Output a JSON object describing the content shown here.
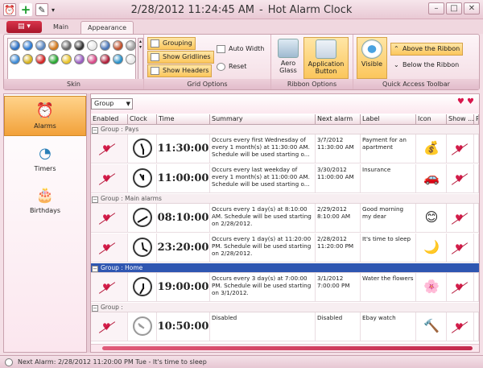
{
  "title": {
    "date": "2/28/2012 11:24:45 AM",
    "sep": "-",
    "app": "Hot Alarm Clock"
  },
  "window_buttons": [
    "–",
    "□",
    "✕"
  ],
  "tabs": {
    "main": "Main",
    "appearance": "Appearance"
  },
  "ribbon": {
    "skin": {
      "label": "Skin",
      "swatches": [
        "#2b6fc4",
        "#2b79d3",
        "#5a86c0",
        "#d3791c",
        "#666",
        "#333",
        "#e8e8e8",
        "#4a75b8",
        "#c04f2a",
        "#a0a0a0",
        "#3d8ad6",
        "#d6b21c",
        "#d52525",
        "#29a832",
        "#e8c32a",
        "#9a5dc0",
        "#d84b89",
        "#b01f3a",
        "#2a91c8",
        "#e8e8e8"
      ]
    },
    "grid_options": {
      "label": "Grid Options",
      "grouping": "Grouping",
      "show_gridlines": "Show Gridlines",
      "show_headers": "Show Headers",
      "auto_width": "Auto Width",
      "reset": "Reset"
    },
    "ribbon_options": {
      "label": "Ribbon Options",
      "aero_line1": "Aero",
      "aero_line2": "Glass",
      "app_line1": "Application",
      "app_line2": "Button"
    },
    "qat": {
      "label": "Quick Access Toolbar",
      "visible": "Visible",
      "above": "Above the Ribbon",
      "below": "Below the Ribbon"
    }
  },
  "nav": {
    "alarms": "Alarms",
    "timers": "Timers",
    "birthdays": "Birthdays"
  },
  "grid": {
    "group_combo": "Group",
    "headers": [
      "Enabled",
      "Clock",
      "Time",
      "Summary",
      "Next alarm",
      "Label",
      "Icon",
      "Show ...",
      "P"
    ],
    "groups": [
      {
        "title": "Group : Pays",
        "alarms": [
          {
            "time": "11:30:00",
            "summary": "Occurs every first Wednesday of every 1 month(s) at 11:30:00 AM. Schedule will be used starting o...",
            "next": "3/7/2012 11:30:00 AM",
            "label": "Payment for an apartment",
            "icon": "coins-icon",
            "glyph": "💰"
          },
          {
            "time": "11:00:00",
            "summary": "Occurs every last weekday of every 1 month(s) at 11:00:00 AM. Schedule will be used starting o...",
            "next": "3/30/2012 11:00:00 AM",
            "label": "Insurance",
            "icon": "car-icon",
            "glyph": "🚗"
          }
        ]
      },
      {
        "title": "Group : Main alarms",
        "alarms": [
          {
            "time": "08:10:00",
            "summary": "Occurs every 1 day(s) at 8:10:00 AM. Schedule will be used starting on 2/28/2012.",
            "next": "2/29/2012 8:10:00 AM",
            "label": "Good morning my dear",
            "icon": "smiley-icon",
            "glyph": "😊"
          },
          {
            "time": "23:20:00",
            "summary": "Occurs every 1 day(s) at 11:20:00 PM. Schedule will be used starting on 2/28/2012.",
            "next": "2/28/2012 11:20:00 PM",
            "label": "It's time to sleep",
            "icon": "moon-icon",
            "glyph": "🌙"
          }
        ]
      },
      {
        "title": "Group : Home",
        "alarms": [
          {
            "time": "19:00:00",
            "summary": "Occurs every 3 day(s) at 7:00:00 PM. Schedule will be used starting on 3/1/2012.",
            "next": "3/1/2012 7:00:00 PM",
            "label": "Water the flowers",
            "icon": "flowers-icon",
            "glyph": "🌸"
          }
        ]
      },
      {
        "title": "Group :",
        "alarms": [
          {
            "time": "10:50:00",
            "summary": "Disabled",
            "next": "Disabled",
            "label": "Ebay watch",
            "icon": "gavel-icon",
            "glyph": "🔨"
          }
        ]
      }
    ]
  },
  "status": {
    "text": "Next Alarm: 2/28/2012 11:20:00 PM Tue - It's time to sleep"
  },
  "colors": {
    "accent": "#2f56b1",
    "heart": "#d41d4a"
  }
}
